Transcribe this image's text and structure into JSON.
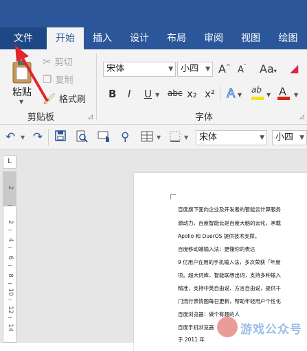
{
  "tabs": [
    {
      "label": "文件",
      "id": "file"
    },
    {
      "label": "开始",
      "id": "home",
      "active": true
    },
    {
      "label": "插入",
      "id": "insert"
    },
    {
      "label": "设计",
      "id": "design"
    },
    {
      "label": "布局",
      "id": "layout"
    },
    {
      "label": "审阅",
      "id": "review"
    },
    {
      "label": "视图",
      "id": "view"
    },
    {
      "label": "绘图",
      "id": "draw"
    }
  ],
  "clipboard": {
    "paste_label": "粘贴",
    "cut_label": "剪切",
    "copy_label": "复制",
    "format_painter_label": "格式刷",
    "group_label": "剪贴板"
  },
  "font": {
    "font_name": "宋体",
    "font_size": "小四",
    "group_label": "字体",
    "grow_label": "A",
    "shrink_label": "A",
    "bold_label": "B",
    "italic_label": "I",
    "underline_label": "U",
    "strike_label": "abc",
    "subscript_label": "x₂",
    "superscript_label": "x²",
    "effects_label": "A",
    "highlight_label": "ab",
    "color_label": "A",
    "highlight_color": "#f5e21a",
    "font_color": "#d9261c"
  },
  "qat": {
    "font_name": "宋体",
    "font_size": "小四"
  },
  "ruler": {
    "corner_label": "L",
    "numbers": [
      "2",
      "2",
      "4",
      "6",
      "8",
      "10",
      "12",
      "14"
    ]
  },
  "document": {
    "lines": [
      "百度旗下面向企业及开发者的智能云计算服务",
      "源动力，百度智能云是百度大脑的云化，承载",
      "Apollo 和 DuerOS 提供技术支撑。",
      "百度移动端输入法：更懂你的表达",
      "9 亿用户在用的手机输入法，多次荣获「年度",
      "项。超大词库，智能联想出词，支持多种输入",
      "精准，支持中英自由说、方言自由说，提供千",
      "门流行表情图每日更新，帮助年轻用户个性化",
      "百度浏览器：做个有趣的人",
      "百度手机浏览器",
      "于 2011 年"
    ]
  },
  "watermark": {
    "text": "游戏公众号"
  },
  "colors": {
    "ribbon_blue": "#2b579a",
    "arrow_red": "#e3262c"
  }
}
